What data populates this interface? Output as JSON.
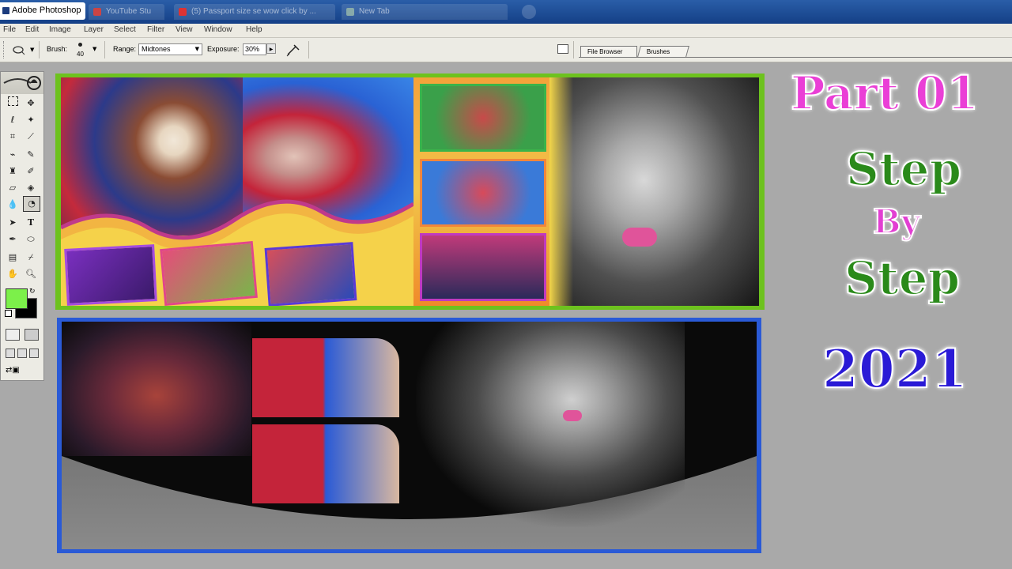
{
  "window": {
    "app_title": "Adobe Photoshop",
    "browser_tabs": [
      "YouTube Stu",
      "(5) Passport size se wow click by ...",
      "New Tab"
    ]
  },
  "menu": [
    "File",
    "Edit",
    "Image",
    "Layer",
    "Select",
    "Filter",
    "View",
    "Window",
    "Help"
  ],
  "options": {
    "brush_label": "Brush:",
    "brush_size": "40",
    "range_label": "Range:",
    "range_value": "Midtones",
    "exposure_label": "Exposure:",
    "exposure_value": "30%"
  },
  "palette_tabs": [
    "File Browser",
    "Brushes"
  ],
  "colors": {
    "foreground": "#7cf04a",
    "background": "#000000",
    "spread1_border": "#6dc21e",
    "spread2_border": "#2a5ad6"
  },
  "overlay": {
    "part": "Part 01",
    "step1": "Step",
    "by": "By",
    "step2": "Step",
    "year": "2021"
  }
}
